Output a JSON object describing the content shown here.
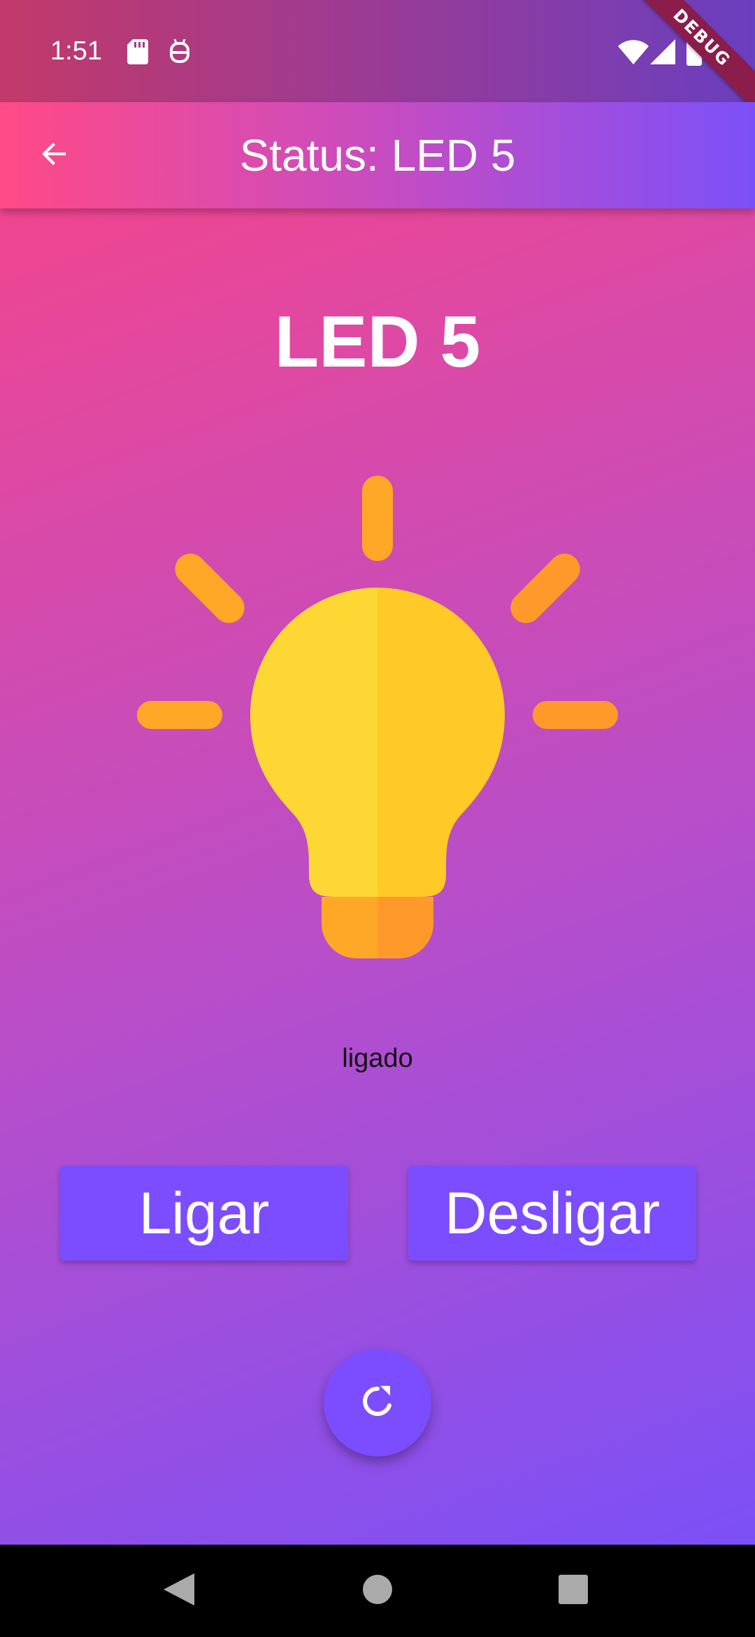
{
  "status_bar": {
    "time": "1:51",
    "debug_label": "DEBUG",
    "icons": [
      "sd-card-icon",
      "android-robot-icon",
      "wifi-icon",
      "cell-signal-icon",
      "battery-icon"
    ]
  },
  "app_bar": {
    "back_icon": "arrow-back-icon",
    "title": "Status: LED 5"
  },
  "device": {
    "name": "LED 5",
    "state_text": "ligado",
    "icon": "lightbulb-icon"
  },
  "actions": {
    "on_label": "Ligar",
    "off_label": "Desligar",
    "refresh_icon": "refresh-icon"
  },
  "colors": {
    "accent": "#7c4dff",
    "gradient_start": "#ff4281",
    "gradient_end": "#7b50f7",
    "bulb_yellow": "#fdd835",
    "bulb_orange": "#ffa726"
  },
  "nav_bar": {
    "icons": [
      "back-triangle-icon",
      "home-circle-icon",
      "recents-square-icon"
    ]
  }
}
